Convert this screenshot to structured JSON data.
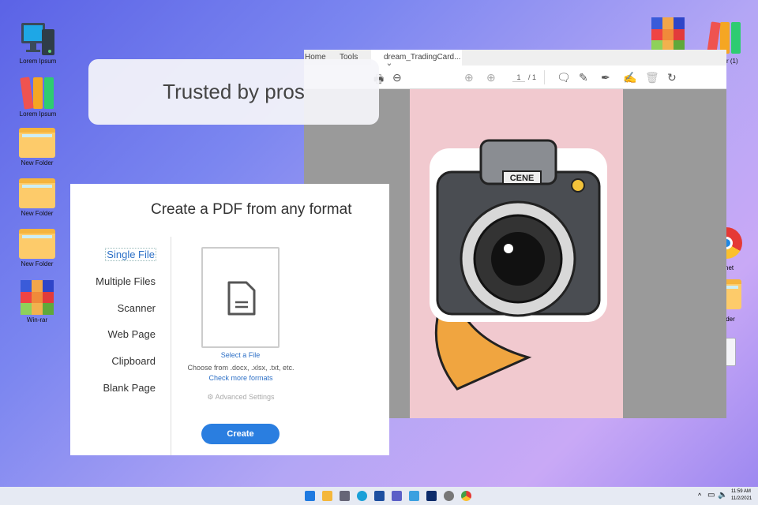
{
  "desktop": {
    "left_icons": [
      "Lorem Ipsum",
      "Lorem Ipsum",
      "New Folder",
      "New Folder",
      "New Folder",
      "Win-rar"
    ],
    "right_icons": [
      "r (1)",
      "net",
      "older"
    ]
  },
  "banner": {
    "text": "Trusted by pros"
  },
  "viewer": {
    "menu": [
      "Home",
      "Tools"
    ],
    "tab_title": "dream_TradingCard...",
    "tab_close": "×",
    "page_current": "1",
    "page_total": "/ 1",
    "sticker_text": "CENE"
  },
  "create_panel": {
    "title": "Create a PDF from any format",
    "nav": [
      "Single File",
      "Multiple Files",
      "Scanner",
      "Web Page",
      "Clipboard",
      "Blank Page"
    ],
    "select_file": "Select a File",
    "choose_from": "Choose from .docx, .xlsx, .txt, etc.",
    "check_formats": "Check more formats",
    "advanced": "Advanced Settings",
    "create": "Create"
  },
  "taskbar": {
    "time": "11:59 AM",
    "date": "11/2/2021",
    "tray_chevron": "^"
  },
  "colors": {
    "accent": "#2a7ee0",
    "link": "#2c6fc6"
  }
}
